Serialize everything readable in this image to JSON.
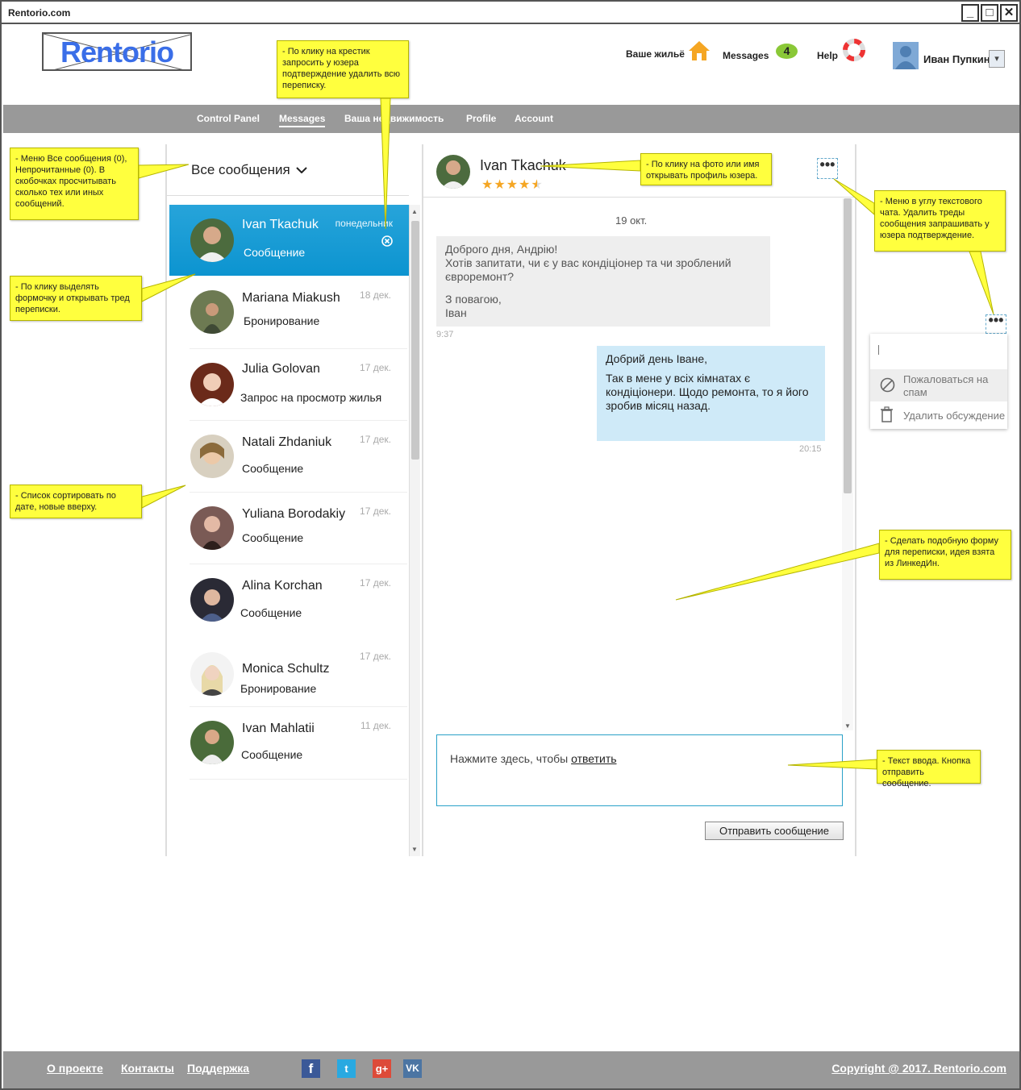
{
  "window": {
    "title": "Rentorio.com",
    "minimize": "_",
    "maximize": "□",
    "close": "✕"
  },
  "header": {
    "logo": "Rentorio",
    "your_housing": "Ваше жильё",
    "messages": "Messages",
    "messages_count": "4",
    "help": "Help",
    "user_name": "Иван Пупкин",
    "user_dropdown": "▾"
  },
  "nav": {
    "items": [
      "Control Panel",
      "Messages",
      "Ваша недвижимость",
      "Profile",
      "Account"
    ],
    "active": "Messages"
  },
  "inbox": {
    "filter_label": "Все сообщения",
    "conversations": [
      {
        "name": "Ivan Tkachuk",
        "subject": "Сообщение",
        "date": "понедельник",
        "active": true
      },
      {
        "name": "Mariana Miakush",
        "subject": "Бронирование",
        "date": "18 дек."
      },
      {
        "name": "Julia Golovan",
        "subject": "Запрос на просмотр жилья",
        "date": "17 дек."
      },
      {
        "name": "Natali Zhdaniuk",
        "subject": "Сообщение",
        "date": "17 дек."
      },
      {
        "name": "Yuliana Borodakiy",
        "subject": "Сообщение",
        "date": "17 дек."
      },
      {
        "name": "Alina Korchan",
        "subject": "Сообщение",
        "date": "17 дек."
      },
      {
        "name": "Monica Schultz",
        "subject": "Бронирование",
        "date": "17 дек."
      },
      {
        "name": "Ivan Mahlatii",
        "subject": "Сообщение",
        "date": "11 дек."
      }
    ]
  },
  "chat": {
    "contact_name": "Ivan Tkachuk",
    "rating": 4.5,
    "rating_stars": "★★★★★",
    "menu_dots": "•••",
    "day_label": "19 окт.",
    "messages": [
      {
        "lines": [
          "Доброго дня, Андрію!",
          "Хотів запитати, чи є у вас кондіціонер та чи зроблений євроремонт?",
          "З повагою,",
          "Іван"
        ],
        "time": "9:37",
        "direction": "in"
      },
      {
        "lines": [
          "Добрий день Іване,",
          "Так в мене у всіх кімнатах є кондіціонери. Щодо ремонта, то я його зробив місяц назад."
        ],
        "time": "20:15",
        "direction": "out"
      }
    ],
    "reply_placeholder": "Нажмите здесь, чтобы",
    "reply_link": "ответить",
    "send_button": "Отправить сообщение"
  },
  "context_menu": {
    "items": [
      {
        "label": "Пожаловаться на спам",
        "icon": "block-icon"
      },
      {
        "label": "Удалить обсуждение",
        "icon": "trash-icon"
      }
    ]
  },
  "annotations": {
    "filter_note": "- Меню Все сообщения (0), Непрочитанные (0). В скобочках просчитывать сколько тех или иных сообщений.",
    "delete_note": "- По клику на крестик запросить у юзера подтверждение удалить всю переписку.",
    "profile_note": "- По клику на фото или имя открывать профиль юзера.",
    "chat_menu_note": "- Меню в углу текстового чата. Удалить треды сообщения запрашивать у юзера подтверждение.",
    "select_note": "- По клику выделять формочку и открывать тред переписки.",
    "sort_note": "- Список сортировать по дате, новые вверху.",
    "linkedin_note": "- Сделать подобную форму для переписки, идея взята из ЛинкедИн.",
    "input_note": "- Текст ввода. Кнопка отправить сообщение."
  },
  "footer": {
    "links": [
      "О проекте",
      "Контакты",
      "Поддержка"
    ],
    "social": [
      "f",
      "t",
      "g+",
      "VK"
    ],
    "copyright": "Copyright @ 2017. Rentorio.com"
  },
  "colors": {
    "accent": "#0c94d0",
    "note": "#ffff3e",
    "nav": "#999999",
    "badge": "#8ac837",
    "reply_border": "#2aa1c8"
  }
}
